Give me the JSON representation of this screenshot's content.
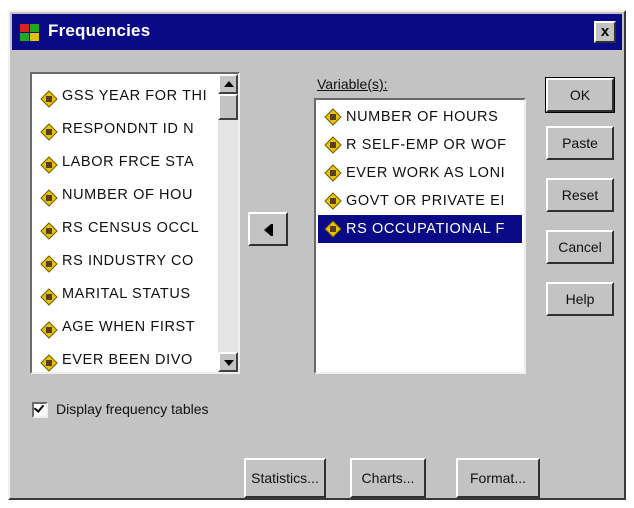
{
  "window": {
    "title": "Frequencies",
    "close_label": "x"
  },
  "source_list": {
    "items": [
      {
        "label": "GSS YEAR FOR THI",
        "icon": "ruler-icon"
      },
      {
        "label": "RESPONDNT ID N",
        "icon": "ruler-icon"
      },
      {
        "label": "LABOR FRCE STA",
        "icon": "ruler-icon"
      },
      {
        "label": "NUMBER OF HOU",
        "icon": "ruler-icon"
      },
      {
        "label": "RS CENSUS OCCL",
        "icon": "ruler-icon"
      },
      {
        "label": "RS INDUSTRY CO",
        "icon": "ruler-icon"
      },
      {
        "label": "MARITAL STATUS",
        "icon": "ruler-icon"
      },
      {
        "label": "AGE WHEN FIRST",
        "icon": "ruler-icon"
      },
      {
        "label": "EVER BEEN DIVO",
        "icon": "ruler-icon"
      }
    ]
  },
  "variables": {
    "label": "Variable(s):",
    "items": [
      {
        "label": "NUMBER OF HOURS",
        "icon": "ruler-icon",
        "selected": false
      },
      {
        "label": "R SELF-EMP OR WOF",
        "icon": "ruler-icon",
        "selected": false
      },
      {
        "label": "EVER WORK AS LONI",
        "icon": "ruler-icon",
        "selected": false
      },
      {
        "label": "GOVT OR PRIVATE EI",
        "icon": "ruler-icon",
        "selected": false
      },
      {
        "label": "RS OCCUPATIONAL F",
        "icon": "ruler-icon",
        "selected": true
      }
    ]
  },
  "buttons": {
    "ok": "OK",
    "paste": "Paste",
    "reset": "Reset",
    "cancel": "Cancel",
    "help": "Help",
    "statistics": "Statistics...",
    "charts": "Charts...",
    "format": "Format..."
  },
  "checkbox": {
    "label": "Display frequency tables",
    "checked": true
  },
  "colors": {
    "titlebar": "#0a0a86",
    "dialog_face": "#c3c3c3",
    "selection": "#0a0a86"
  }
}
